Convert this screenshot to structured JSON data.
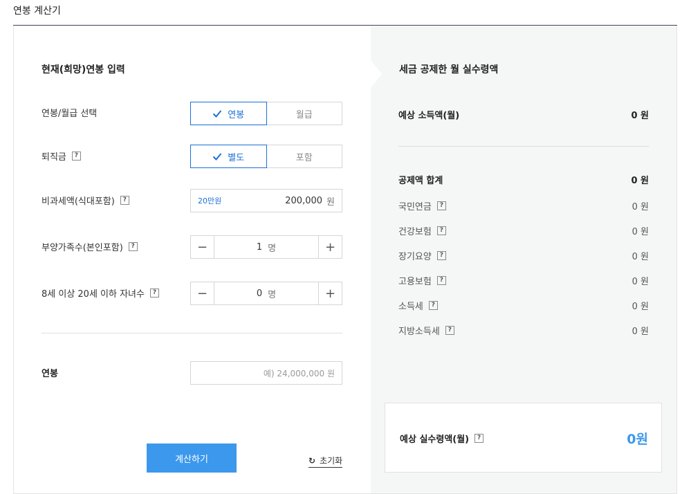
{
  "page_title": "연봉 계산기",
  "left": {
    "section_title": "현재(희망)연봉 입력",
    "pay_type": {
      "label": "연봉/월급 선택",
      "options": [
        "연봉",
        "월급"
      ],
      "selected": "연봉"
    },
    "severance": {
      "label": "퇴직금",
      "help": "?",
      "options": [
        "별도",
        "포함"
      ],
      "selected": "별도"
    },
    "nontaxable": {
      "label": "비과세액(식대포함)",
      "help": "?",
      "hint": "20만원",
      "value": "200,000",
      "unit": "원"
    },
    "dependents": {
      "label": "부양가족수(본인포함)",
      "help": "?",
      "value": "1",
      "unit": "명",
      "minus": "−",
      "plus": "+"
    },
    "children": {
      "label": "8세 이상 20세 이하 자녀수",
      "help": "?",
      "value": "0",
      "unit": "명",
      "minus": "−",
      "plus": "+"
    },
    "salary": {
      "label": "연봉",
      "placeholder": "예) 24,000,000 원"
    },
    "calc_button": "계산하기",
    "reset_label": "초기화",
    "reset_icon": "↻"
  },
  "right": {
    "section_title": "세금 공제한 월 실수령액",
    "expected_income": {
      "label": "예상 소득액(월)",
      "amount": "0 원"
    },
    "deduction_total": {
      "label": "공제액 합계",
      "amount": "0 원"
    },
    "deductions": [
      {
        "label": "국민연금",
        "help": "?",
        "amount": "0 원"
      },
      {
        "label": "건강보험",
        "help": "?",
        "amount": "0 원"
      },
      {
        "label": "장기요양",
        "help": "?",
        "amount": "0 원"
      },
      {
        "label": "고용보험",
        "help": "?",
        "amount": "0 원"
      },
      {
        "label": "소득세",
        "help": "?",
        "amount": "0 원"
      },
      {
        "label": "지방소득세",
        "help": "?",
        "amount": "0 원"
      }
    ],
    "net_pay": {
      "label": "예상 실수령액(월)",
      "help": "?",
      "amount": "0원"
    }
  },
  "colors": {
    "accent": "#1a6fd6",
    "button": "#3c98ec",
    "right_bg": "#f5f6f6"
  }
}
